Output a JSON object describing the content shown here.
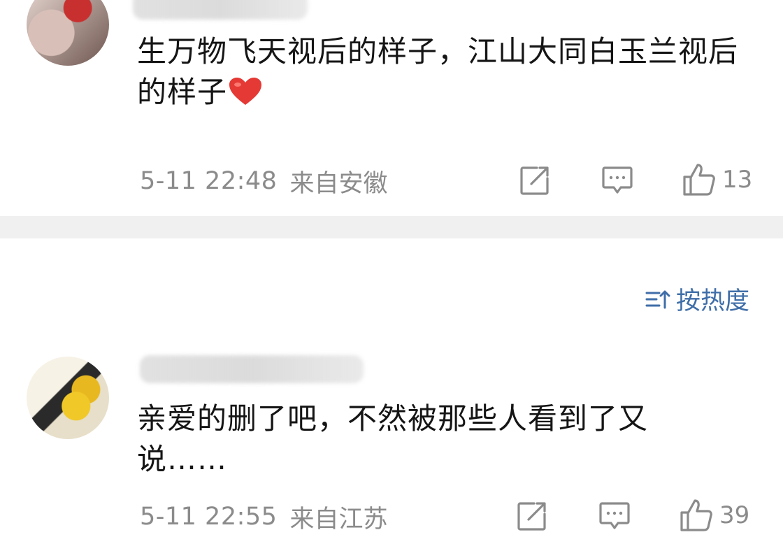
{
  "comments": [
    {
      "text": "生万物飞天视后的样子，江山大同白玉兰视后的样子",
      "time": "5-11 22:48",
      "location": "来自安徽",
      "likes": "13"
    },
    {
      "text": "亲爱的删了吧，不然被那些人看到了又说……",
      "time": "5-11 22:55",
      "location": "来自江苏",
      "likes": "39"
    }
  ],
  "sort": {
    "label": "按热度"
  },
  "colors": {
    "link": "#3f6ea8",
    "muted": "#8b8b8b",
    "separator": "#f0f0f0",
    "heart": "#e53935"
  },
  "icons": {
    "share": "share-icon",
    "comment": "comment-icon",
    "like": "thumbs-up-icon",
    "heart": "heart-icon",
    "sort": "sort-icon"
  }
}
